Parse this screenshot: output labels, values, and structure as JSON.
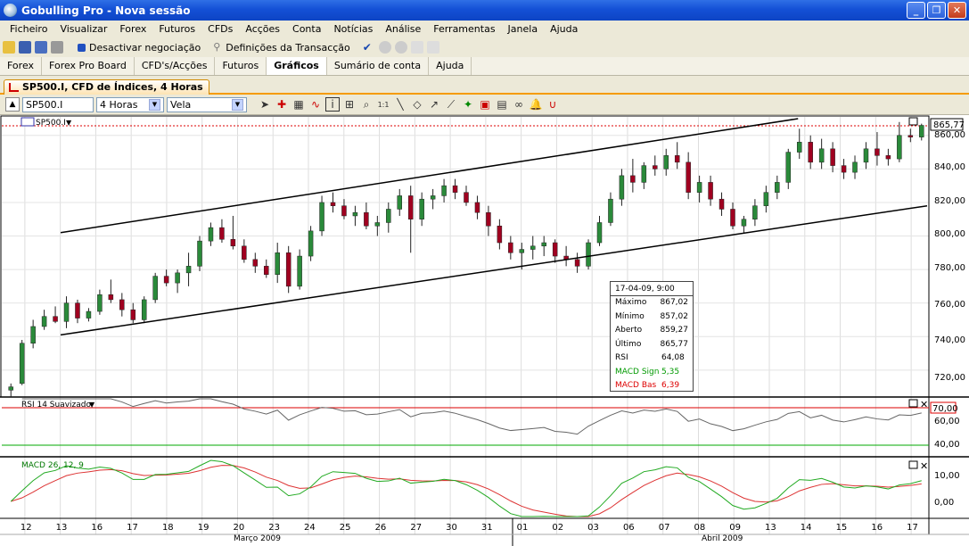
{
  "window": {
    "title": "Gobulling Pro - Nova sessão"
  },
  "menu": [
    "Ficheiro",
    "Visualizar",
    "Forex",
    "Futuros",
    "CFDs",
    "Acções",
    "Conta",
    "Notícias",
    "Análise",
    "Ferramentas",
    "Janela",
    "Ajuda"
  ],
  "toolbar": {
    "deactivate_label": "Desactivar negociação",
    "transaction_label": "Definições da Transacção"
  },
  "tabs": [
    "Forex",
    "Forex Pro Board",
    "CFD's/Acções",
    "Futuros",
    "Gráficos",
    "Sumário de conta",
    "Ajuda"
  ],
  "active_tab": "Gráficos",
  "doc_tab": "SP500.I, CFD de Índices, 4 Horas",
  "chart_toolbar": {
    "symbol": "SP500.I",
    "period": "4 Horas",
    "chart_type": "Vela"
  },
  "main_panel": {
    "symbol_label": "SP500.I",
    "last_price_label": "865,77",
    "price_axis": [
      "860,00",
      "840,00",
      "820,00",
      "800,00",
      "780,00",
      "760,00",
      "740,00",
      "720,00"
    ]
  },
  "rsi_panel": {
    "title": "RSI 14 Suavizado",
    "level_label": "70,00",
    "axis": [
      "60,00",
      "40,00"
    ]
  },
  "macd_panel": {
    "title": "MACD 26, 12, 9",
    "axis": [
      "10,00",
      "0,00"
    ]
  },
  "x_axis": {
    "days": [
      "12",
      "13",
      "16",
      "17",
      "18",
      "19",
      "20",
      "23",
      "24",
      "25",
      "26",
      "27",
      "30",
      "31",
      "01",
      "02",
      "03",
      "06",
      "07",
      "08",
      "09",
      "13",
      "14",
      "15",
      "16",
      "17"
    ],
    "months": [
      "Março 2009",
      "Abril 2009"
    ]
  },
  "tooltip": {
    "header": "17-04-09, 9:00",
    "rows": [
      {
        "label": "Máximo",
        "value": "867,02"
      },
      {
        "label": "Mínimo",
        "value": "857,02"
      },
      {
        "label": "Aberto",
        "value": "859,27"
      },
      {
        "label": "Último",
        "value": "865,77"
      },
      {
        "label": "RSI",
        "value": "64,08"
      },
      {
        "label": "MACD Sign",
        "value": "5,35"
      },
      {
        "label": "MACD Bas",
        "value": "6,39"
      }
    ]
  },
  "chart_data": {
    "type": "candlestick",
    "ylim": [
      705,
      870
    ],
    "ohlc": [
      [
        708,
        712,
        704,
        710
      ],
      [
        712,
        738,
        711,
        736
      ],
      [
        736,
        750,
        733,
        746
      ],
      [
        746,
        756,
        744,
        752
      ],
      [
        752,
        758,
        748,
        749
      ],
      [
        749,
        764,
        745,
        760
      ],
      [
        760,
        762,
        748,
        751
      ],
      [
        751,
        757,
        749,
        755
      ],
      [
        755,
        768,
        753,
        765
      ],
      [
        765,
        774,
        760,
        762
      ],
      [
        762,
        766,
        752,
        756
      ],
      [
        756,
        760,
        748,
        750
      ],
      [
        750,
        764,
        748,
        762
      ],
      [
        762,
        778,
        760,
        776
      ],
      [
        776,
        780,
        770,
        772
      ],
      [
        772,
        780,
        766,
        778
      ],
      [
        778,
        790,
        770,
        782
      ],
      [
        782,
        800,
        779,
        797
      ],
      [
        797,
        808,
        794,
        805
      ],
      [
        805,
        810,
        796,
        798
      ],
      [
        798,
        812,
        792,
        794
      ],
      [
        794,
        798,
        784,
        786
      ],
      [
        786,
        790,
        778,
        782
      ],
      [
        782,
        786,
        775,
        777
      ],
      [
        777,
        796,
        772,
        790
      ],
      [
        790,
        794,
        766,
        770
      ],
      [
        770,
        792,
        768,
        788
      ],
      [
        788,
        806,
        785,
        803
      ],
      [
        803,
        824,
        800,
        820
      ],
      [
        820,
        826,
        814,
        818
      ],
      [
        818,
        822,
        810,
        812
      ],
      [
        812,
        818,
        806,
        814
      ],
      [
        814,
        820,
        804,
        806
      ],
      [
        806,
        812,
        800,
        808
      ],
      [
        808,
        820,
        802,
        816
      ],
      [
        816,
        828,
        812,
        824
      ],
      [
        824,
        830,
        790,
        810
      ],
      [
        810,
        826,
        806,
        822
      ],
      [
        822,
        828,
        816,
        824
      ],
      [
        824,
        834,
        820,
        830
      ],
      [
        830,
        834,
        822,
        826
      ],
      [
        826,
        830,
        818,
        820
      ],
      [
        820,
        824,
        810,
        814
      ],
      [
        814,
        818,
        800,
        806
      ],
      [
        806,
        810,
        792,
        796
      ],
      [
        796,
        800,
        786,
        790
      ],
      [
        790,
        796,
        780,
        792
      ],
      [
        792,
        800,
        786,
        794
      ],
      [
        794,
        800,
        788,
        796
      ],
      [
        796,
        798,
        784,
        788
      ],
      [
        788,
        794,
        782,
        786
      ],
      [
        786,
        790,
        778,
        782
      ],
      [
        782,
        798,
        780,
        796
      ],
      [
        796,
        812,
        794,
        808
      ],
      [
        808,
        826,
        806,
        822
      ],
      [
        822,
        840,
        818,
        836
      ],
      [
        836,
        846,
        826,
        832
      ],
      [
        832,
        844,
        828,
        842
      ],
      [
        842,
        848,
        836,
        840
      ],
      [
        840,
        852,
        836,
        848
      ],
      [
        848,
        856,
        840,
        844
      ],
      [
        844,
        850,
        822,
        826
      ],
      [
        826,
        836,
        820,
        832
      ],
      [
        832,
        836,
        818,
        822
      ],
      [
        822,
        826,
        812,
        816
      ],
      [
        816,
        820,
        804,
        806
      ],
      [
        806,
        812,
        802,
        810
      ],
      [
        810,
        822,
        806,
        818
      ],
      [
        818,
        830,
        814,
        826
      ],
      [
        826,
        836,
        822,
        832
      ],
      [
        832,
        852,
        828,
        850
      ],
      [
        850,
        864,
        846,
        856
      ],
      [
        856,
        860,
        840,
        844
      ],
      [
        844,
        858,
        840,
        852
      ],
      [
        852,
        856,
        838,
        842
      ],
      [
        842,
        846,
        834,
        838
      ],
      [
        838,
        848,
        834,
        844
      ],
      [
        844,
        856,
        840,
        852
      ],
      [
        852,
        862,
        842,
        848
      ],
      [
        848,
        852,
        842,
        846
      ],
      [
        846,
        868,
        844,
        860
      ],
      [
        860,
        864,
        856,
        859
      ],
      [
        859,
        867,
        857,
        866
      ]
    ],
    "channel": {
      "upper": [
        [
          0.06,
          802
        ],
        [
          0.86,
          870
        ]
      ],
      "lower": [
        [
          0.06,
          741
        ],
        [
          1.0,
          818
        ]
      ]
    }
  }
}
